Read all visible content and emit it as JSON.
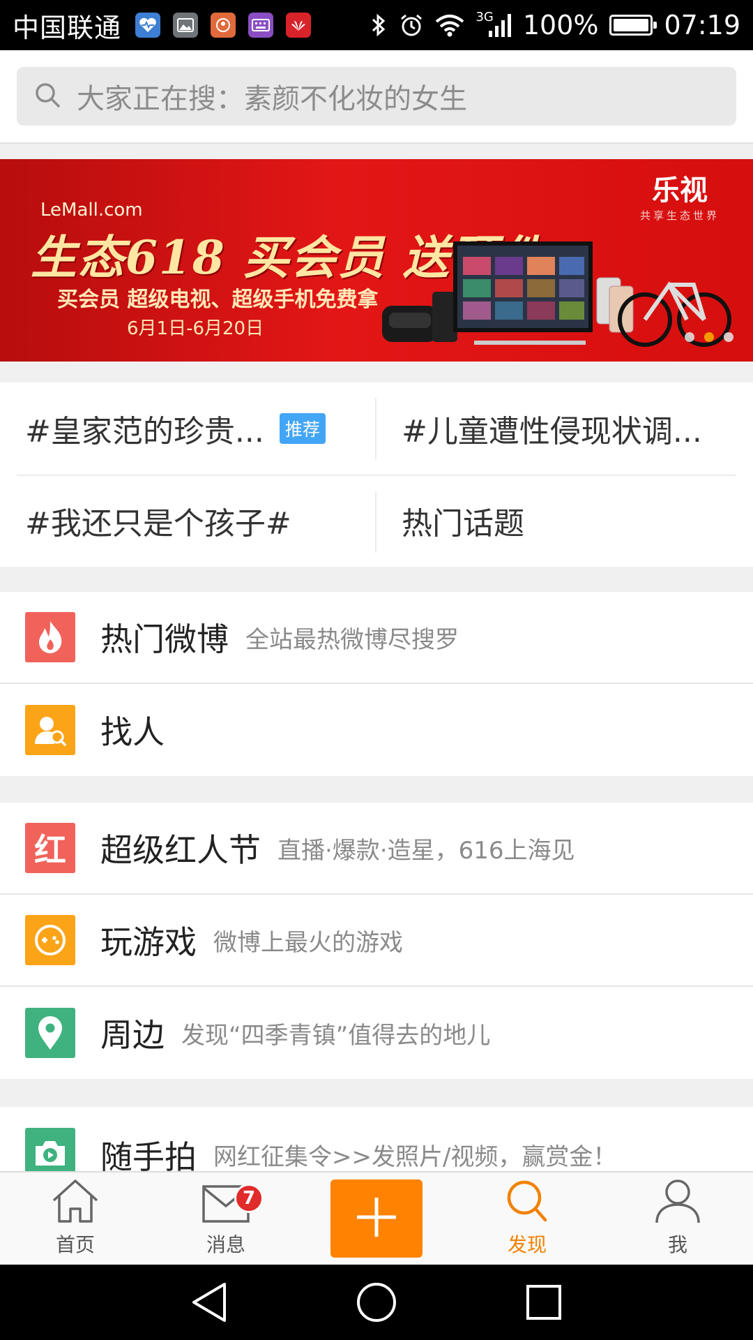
{
  "status_bar": {
    "carrier": "中国联通",
    "network": "3G",
    "battery": "100%",
    "battery_level": 1.0,
    "time": "07:19",
    "app_icons": [
      "health-icon",
      "gallery-icon",
      "app-icon",
      "keyboard-icon",
      "huawei-icon"
    ]
  },
  "search": {
    "placeholder": "大家正在搜：素颜不化妆的女生"
  },
  "banner": {
    "brand": "LeMall.com",
    "title": "生态618 买会员 送硬件",
    "subtitle": "买会员 超级电视、超级手机免费拿",
    "date": "6月1日-6月20日",
    "logo_text": "乐视",
    "logo_sub": "共享生态世界",
    "slide_count": 3,
    "active_slide": 2
  },
  "topics": {
    "items": [
      {
        "label": "#皇家范的珍贵...",
        "tag": "推荐"
      },
      {
        "label": "#儿童遭性侵现状调..."
      },
      {
        "label": "#我还只是个孩子#"
      },
      {
        "label": "热门话题"
      }
    ]
  },
  "menu": {
    "group1": [
      {
        "title": "热门微博",
        "desc": "全站最热微博尽搜罗",
        "color": "#f0625a",
        "icon": "flame-icon"
      },
      {
        "title": "找人",
        "desc": "",
        "color": "#fba418",
        "icon": "find-people-icon"
      }
    ],
    "group2": [
      {
        "title": "超级红人节",
        "desc": "直播·爆款·造星，616上海见",
        "color": "#f0625a",
        "icon": "hong-icon",
        "icon_text": "红"
      },
      {
        "title": "玩游戏",
        "desc": "微博上最火的游戏",
        "color": "#fba418",
        "icon": "gamepad-icon"
      },
      {
        "title": "周边",
        "desc": "发现“四季青镇”值得去的地儿",
        "color": "#3fb27f",
        "icon": "location-icon"
      }
    ],
    "group3": [
      {
        "title": "随手拍",
        "desc": "网红征集令>>发照片/视频，赢赏金！",
        "color": "#3fb27f",
        "icon": "camera-icon"
      }
    ]
  },
  "tabbar": {
    "home": "首页",
    "messages": "消息",
    "messages_badge": "7",
    "discover": "发现",
    "me": "我",
    "active_color": "#f08200",
    "compose_color": "#ff8200"
  }
}
